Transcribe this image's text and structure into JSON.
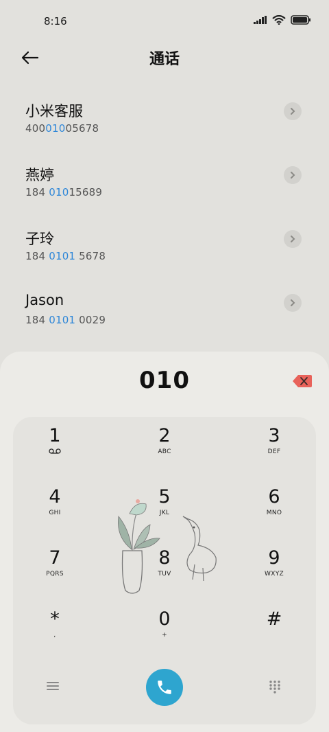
{
  "status": {
    "time": "8:16"
  },
  "header": {
    "title": "通话"
  },
  "contacts": [
    {
      "name": "小米客服",
      "number_pre": "400",
      "number_match": "010",
      "number_post": "05678"
    },
    {
      "name": "燕婷",
      "number_pre": "184 ",
      "number_match": "010",
      "number_post": "15689"
    },
    {
      "name": "子玲",
      "number_pre": "184 ",
      "number_match": "0101",
      "number_post": " 5678"
    },
    {
      "name": "Jason",
      "number_pre": "184 ",
      "number_match": "0101",
      "number_post": " 0029"
    }
  ],
  "dialer": {
    "input": "010",
    "keys": [
      {
        "digit": "1",
        "letters": "voicemail-icon"
      },
      {
        "digit": "2",
        "letters": "ABC"
      },
      {
        "digit": "3",
        "letters": "DEF"
      },
      {
        "digit": "4",
        "letters": "GHI"
      },
      {
        "digit": "5",
        "letters": "JKL"
      },
      {
        "digit": "6",
        "letters": "MNO"
      },
      {
        "digit": "7",
        "letters": "PQRS"
      },
      {
        "digit": "8",
        "letters": "TUV"
      },
      {
        "digit": "9",
        "letters": "WXYZ"
      },
      {
        "digit": "*",
        "letters": ","
      },
      {
        "digit": "0",
        "letters": "+"
      },
      {
        "digit": "#",
        "letters": ""
      }
    ],
    "accent_color": "#2ea5cf",
    "backspace_color": "#e8625a"
  }
}
